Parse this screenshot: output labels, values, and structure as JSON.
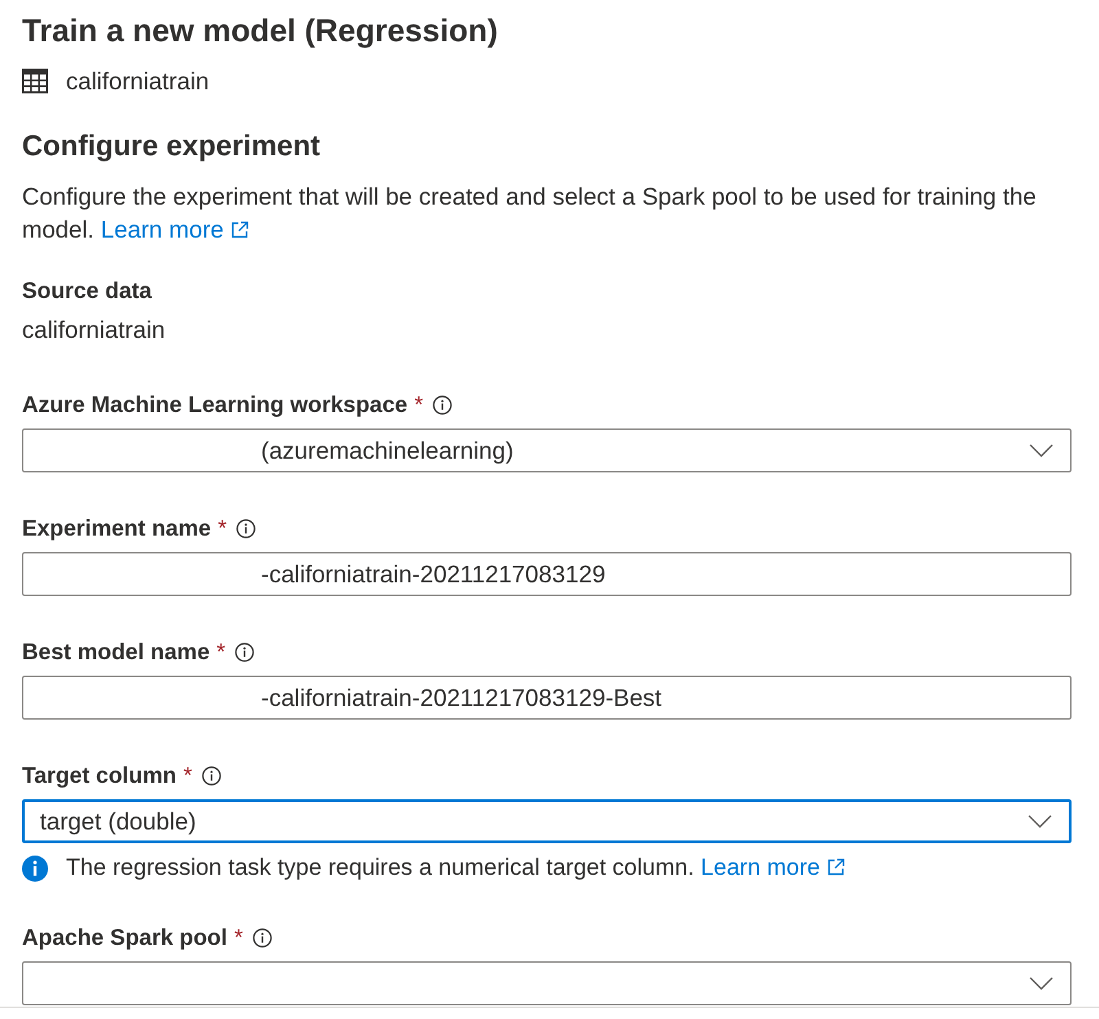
{
  "header": {
    "title": "Train a new model (Regression)",
    "dataset": "californiatrain"
  },
  "section": {
    "title": "Configure experiment",
    "description": "Configure the experiment that will be created and select a Spark pool to be used for training the model.",
    "link": "Learn more"
  },
  "source_data": {
    "label": "Source data",
    "value": "californiatrain"
  },
  "fields": [
    {
      "kind": "dropdown",
      "label": "Azure Machine Learning workspace",
      "required_mark": "*",
      "value": "(azuremachinelearning)",
      "masked_prefix": true,
      "focused": false
    },
    {
      "kind": "text",
      "label": "Experiment name",
      "required_mark": "*",
      "value": "-californiatrain-20211217083129",
      "masked_prefix": true,
      "focused": false
    },
    {
      "kind": "text",
      "label": "Best model name",
      "required_mark": "*",
      "value": "-californiatrain-20211217083129-Best",
      "masked_prefix": true,
      "focused": false
    },
    {
      "kind": "dropdown",
      "label": "Target column",
      "required_mark": "*",
      "value": "target (double)",
      "masked_prefix": false,
      "focused": true,
      "message": {
        "text": "The regression task type requires a numerical target column.",
        "link": "Learn more"
      }
    },
    {
      "kind": "dropdown",
      "label": "Apache Spark pool",
      "required_mark": "*",
      "focused": false
    }
  ]
}
